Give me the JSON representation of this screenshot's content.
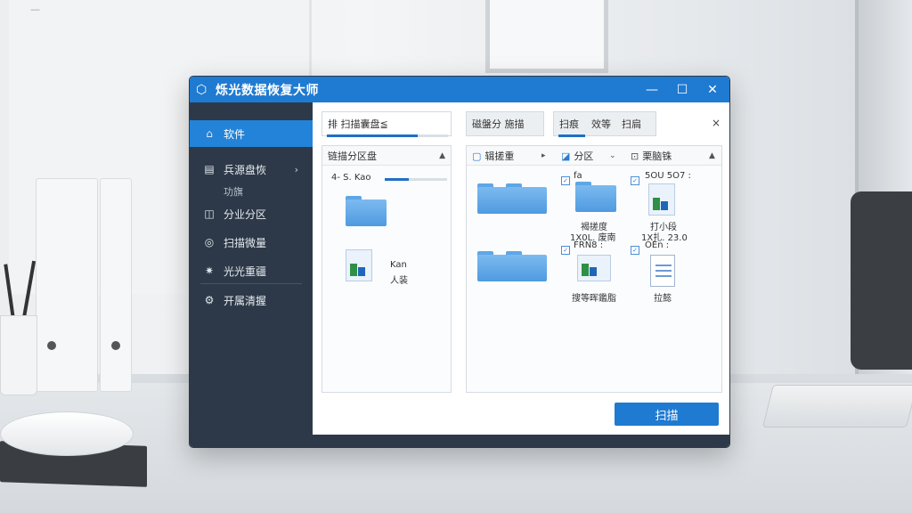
{
  "window": {
    "title": "烁光数据恢复大师",
    "controls": {
      "minimize": "—",
      "maximize": "☐",
      "close": "✕"
    }
  },
  "sidebar": {
    "items": [
      {
        "label": "软件",
        "icon": "home-icon",
        "glyph": "⌂",
        "active": true
      },
      {
        "label": "兵源盘恢",
        "icon": "disk-icon",
        "glyph": "▤",
        "sub": "功旗"
      },
      {
        "label": "分业分区",
        "icon": "partition-icon",
        "glyph": "◫"
      },
      {
        "label": "扫描微量",
        "icon": "scan-icon",
        "glyph": "◎"
      },
      {
        "label": "光光重疆",
        "icon": "sun-icon",
        "glyph": "✷"
      },
      {
        "label": "开属清握",
        "icon": "settings-icon",
        "glyph": "⚙"
      }
    ]
  },
  "tabs": {
    "left": "排 扫描囊盘≦",
    "middle": "磁盤分  施描",
    "right_a": "扫痕",
    "right_b": "效等",
    "right_c": "扫扃",
    "close": "×"
  },
  "left_panel": {
    "header": "链描分区盘",
    "row1": "4- S. Kao",
    "item_label_1": "Kan",
    "item_label_2": "人装"
  },
  "right_panel": {
    "col1": "辑搓重",
    "col2": "分区",
    "col3": "栗脑铢",
    "tag1": "fa",
    "tag2": "5OU 5O7 :",
    "tag3": "FRN8 :",
    "tag4": "OEn :",
    "file1": "褐搓度",
    "file1b": "1X0L. 废南",
    "file2": "打小段",
    "file2b": "1X扎. 23.0",
    "file3": "搜等晖鑑脂",
    "file4": "拉懿"
  },
  "scan_button": "扫描",
  "colors": {
    "accent": "#1f7ad1",
    "sidebar": "#2d3948"
  }
}
